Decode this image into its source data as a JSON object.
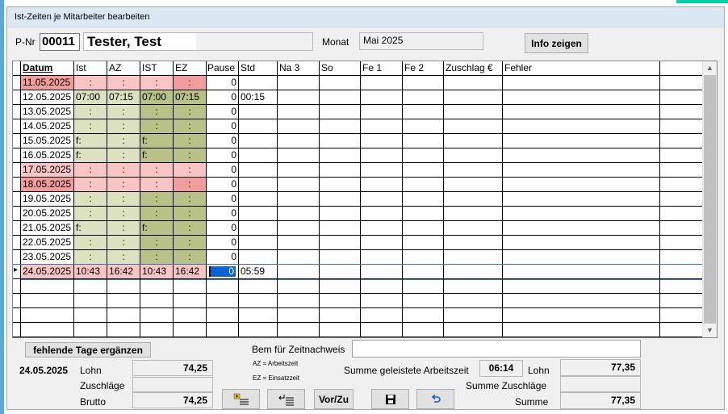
{
  "window": {
    "title": "Ist-Zeiten je Mitarbeiter bearbeiten"
  },
  "header": {
    "pnr_label": "P-Nr",
    "pnr_value": "00011",
    "name_value": "Tester, Test",
    "monat_label": "Monat",
    "monat_value": "Mai 2025",
    "info_button": "Info zeigen"
  },
  "table": {
    "columns": [
      "Datum",
      "Ist",
      "AZ",
      "IST",
      "EZ",
      "Pause",
      "Std",
      "Na 3",
      "So",
      "Fe 1",
      "Fe 2",
      "Zuschlag €",
      "Fehler",
      ""
    ],
    "rows": [
      {
        "datum": "11.05.2025",
        "ist": ":",
        "az": ":",
        "ist2": ":",
        "ez": ":",
        "pause": "0",
        "std": "",
        "style": "weekend"
      },
      {
        "datum": "12.05.2025",
        "ist": "07:00",
        "az": "07:15",
        "ist2": "07:00",
        "ez": "07:15",
        "pause": "0",
        "std": "00:15",
        "style": "normal"
      },
      {
        "datum": "13.05.2025",
        "ist": ":",
        "az": ":",
        "ist2": ":",
        "ez": ":",
        "pause": "0",
        "std": "",
        "style": "normal"
      },
      {
        "datum": "14.05.2025",
        "ist": ":",
        "az": ":",
        "ist2": ":",
        "ez": ":",
        "pause": "0",
        "std": "",
        "style": "normal"
      },
      {
        "datum": "15.05.2025",
        "ist": "f:",
        "az": ":",
        "ist2": "f:",
        "ez": ":",
        "pause": "0",
        "std": "",
        "style": "normal"
      },
      {
        "datum": "16.05.2025",
        "ist": "f:",
        "az": ":",
        "ist2": "f:",
        "ez": ":",
        "pause": "0",
        "std": "",
        "style": "normal"
      },
      {
        "datum": "17.05.2025",
        "ist": ":",
        "az": ":",
        "ist2": ":",
        "ez": ":",
        "pause": "0",
        "std": "",
        "style": "saturday"
      },
      {
        "datum": "18.05.2025",
        "ist": ":",
        "az": ":",
        "ist2": ":",
        "ez": ":",
        "pause": "0",
        "std": "",
        "style": "weekend"
      },
      {
        "datum": "19.05.2025",
        "ist": ":",
        "az": ":",
        "ist2": ":",
        "ez": ":",
        "pause": "0",
        "std": "",
        "style": "normal"
      },
      {
        "datum": "20.05.2025",
        "ist": ":",
        "az": ":",
        "ist2": ":",
        "ez": ":",
        "pause": "0",
        "std": "",
        "style": "normal"
      },
      {
        "datum": "21.05.2025",
        "ist": "f:",
        "az": ":",
        "ist2": "f:",
        "ez": ":",
        "pause": "0",
        "std": "",
        "style": "normal"
      },
      {
        "datum": "22.05.2025",
        "ist": ":",
        "az": ":",
        "ist2": ":",
        "ez": ":",
        "pause": "0",
        "std": "",
        "style": "normal"
      },
      {
        "datum": "23.05.2025",
        "ist": ":",
        "az": ":",
        "ist2": ":",
        "ez": ":",
        "pause": "0",
        "std": "",
        "style": "normal"
      },
      {
        "datum": "24.05.2025",
        "ist": "10:43",
        "az": "16:42",
        "ist2": "10:43",
        "ez": "16:42",
        "pause": "0",
        "std": "05:59",
        "style": "saturday"
      }
    ]
  },
  "footer": {
    "fehlende_button": "fehlende Tage ergänzen",
    "bem_label": "Bem für Zeitnachweis",
    "bem_value": "",
    "date": "24.05.2025",
    "lohn_label": "Lohn",
    "lohn_value": "74,25",
    "zuschlaege_label": "Zuschläge",
    "zuschlaege_value": "",
    "brutto_label": "Brutto",
    "brutto_value": "74,25",
    "az_note": "AZ = Arbeitszeit",
    "ez_note": "EZ = Einsatzzeit",
    "summe_arbeitszeit_label": "Summe geleistete Arbeitszeit",
    "summe_arbeitszeit_value": "06:14",
    "right_lohn_label": "Lohn",
    "right_lohn_value": "77,35",
    "summe_zuschlaege_label": "Summe Zuschläge",
    "summe_zuschlaege_value": "",
    "summe_label": "Summe",
    "summe_value": "77,35",
    "vorzu_button": "Vor/Zu"
  },
  "colors": {
    "weekend": "#f19d9d",
    "saturday": "#f8c4c4",
    "light_olive": "#dce2c0",
    "olive": "#b8c287"
  }
}
